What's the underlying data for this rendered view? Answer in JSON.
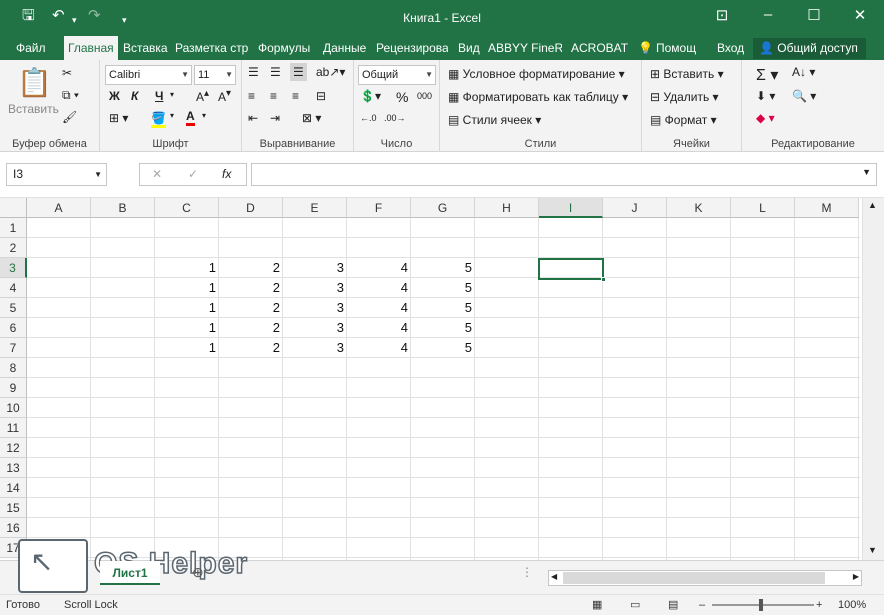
{
  "window": {
    "title": "Книга1 - Excel"
  },
  "tabs": [
    "Файл",
    "Главная",
    "Вставка",
    "Разметка стр",
    "Формулы",
    "Данные",
    "Рецензирова",
    "Вид",
    "ABBYY FineRe",
    "ACROBAT",
    "Помощ",
    "Вход"
  ],
  "share_label": "Общий доступ",
  "ribbon": {
    "clipboard": {
      "paste": "Вставить",
      "label": "Буфер обмена"
    },
    "font": {
      "name": "Calibri",
      "size": "11",
      "bold": "Ж",
      "italic": "К",
      "underline": "Ч",
      "label": "Шрифт"
    },
    "alignment": {
      "label": "Выравнивание"
    },
    "number": {
      "format": "Общий",
      "label": "Число"
    },
    "styles": {
      "conditional": "Условное форматирование",
      "table": "Форматировать как таблицу",
      "cell_styles": "Стили ячеек",
      "label": "Стили"
    },
    "cells": {
      "insert": "Вставить",
      "delete": "Удалить",
      "format": "Формат",
      "label": "Ячейки"
    },
    "editing": {
      "label": "Редактирование"
    }
  },
  "formula_bar": {
    "name_box": "I3",
    "fx": "fx",
    "value": ""
  },
  "columns": [
    "A",
    "B",
    "C",
    "D",
    "E",
    "F",
    "G",
    "H",
    "I",
    "J",
    "K",
    "L",
    "M"
  ],
  "rows": [
    "1",
    "2",
    "3",
    "4",
    "5",
    "6",
    "7",
    "8",
    "9",
    "10",
    "11",
    "12",
    "13",
    "14",
    "15",
    "16",
    "17"
  ],
  "cells": [
    [
      "",
      "",
      "1",
      "2",
      "3",
      "4",
      "5"
    ],
    [
      "",
      "",
      "1",
      "2",
      "3",
      "4",
      "5"
    ],
    [
      "",
      "",
      "1",
      "2",
      "3",
      "4",
      "5"
    ],
    [
      "",
      "",
      "1",
      "2",
      "3",
      "4",
      "5"
    ],
    [
      "",
      "",
      "1",
      "2",
      "3",
      "4",
      "5"
    ]
  ],
  "selected_cell": "I3",
  "sheet_tab": "Лист1",
  "status": {
    "ready": "Готово",
    "scroll_lock": "Scroll Lock",
    "zoom": "100%"
  },
  "watermark": "OS Helper",
  "colors": {
    "accent": "#217346"
  }
}
